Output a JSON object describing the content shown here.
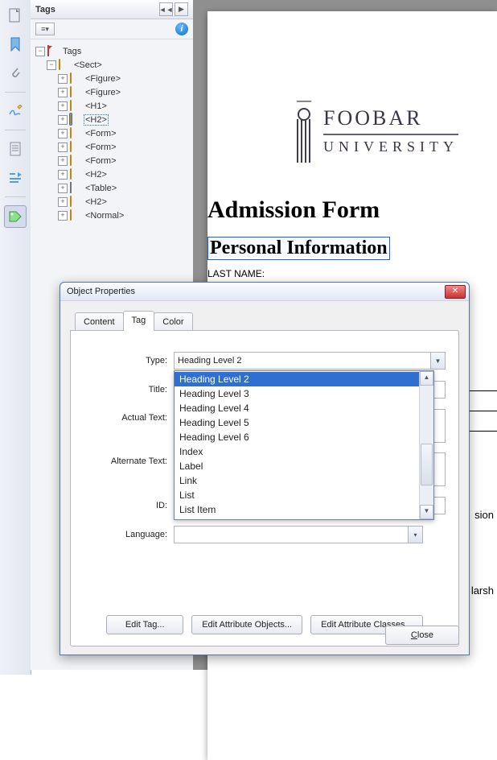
{
  "toolbar": {
    "icons": [
      "page-icon",
      "bookmark-ribbon-icon",
      "paperclip-icon",
      "signature-icon",
      "page-alt-icon",
      "measure-icon",
      "tag-icon"
    ]
  },
  "tags_panel": {
    "title": "Tags",
    "tree": {
      "root": "Tags",
      "sect": "<Sect>",
      "nodes": [
        {
          "label": "<Figure>",
          "icon": "tag"
        },
        {
          "label": "<Figure>",
          "icon": "tag"
        },
        {
          "label": "<H1>",
          "icon": "tag"
        },
        {
          "label": "<H2>",
          "icon": "tag",
          "selected": true
        },
        {
          "label": "<Form>",
          "icon": "tag"
        },
        {
          "label": "<Form>",
          "icon": "tag"
        },
        {
          "label": "<Form>",
          "icon": "tag"
        },
        {
          "label": "<H2>",
          "icon": "tag"
        },
        {
          "label": "<Table>",
          "icon": "table"
        },
        {
          "label": "<H2>",
          "icon": "tag"
        },
        {
          "label": "<Normal>",
          "icon": "tag"
        }
      ]
    }
  },
  "document": {
    "logo_top": "FOOBAR",
    "logo_bottom": "UNIVERSITY",
    "h1": "Admission Form",
    "h2": "Personal Information",
    "field1": "LAST NAME:",
    "rside_word1": "sion",
    "rside_word2": "larsh"
  },
  "dialog": {
    "title": "Object Properties",
    "tabs": {
      "content": "Content",
      "tag": "Tag",
      "color": "Color"
    },
    "labels": {
      "type": "Type:",
      "title": "Title:",
      "actual": "Actual Text:",
      "alt": "Alternate Text:",
      "id": "ID:",
      "lang": "Language:"
    },
    "type_value": "Heading Level 2",
    "dropdown": [
      "Heading Level 2",
      "Heading Level 3",
      "Heading Level 4",
      "Heading Level 5",
      "Heading Level 6",
      "Index",
      "Label",
      "Link",
      "List",
      "List Item"
    ],
    "buttons": {
      "edit_tag": "Edit Tag...",
      "edit_attr_obj": "Edit Attribute Objects...",
      "edit_attr_cls": "Edit Attribute Classes...",
      "close": "Close"
    }
  }
}
